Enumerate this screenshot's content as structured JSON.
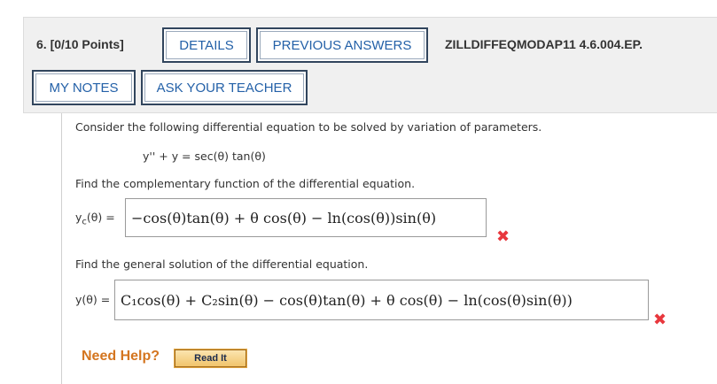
{
  "header": {
    "question_label": "6. [0/10 Points]",
    "details_label": "DETAILS",
    "previous_answers_label": "PREVIOUS ANSWERS",
    "assignment_code": "ZILLDIFFEQMODAP11 4.6.004.EP.",
    "my_notes_label": "MY NOTES",
    "ask_teacher_label": "ASK YOUR TEACHER"
  },
  "question": {
    "prompt": "Consider the following differential equation to be solved by variation of parameters.",
    "equation": "y'' + y = sec(θ) tan(θ)",
    "part1_prompt": "Find the complementary function of the differential equation.",
    "part1_label_var": "y",
    "part1_label_sub": "c",
    "part1_label_rest": "(θ) =",
    "part1_answer": "−cos(θ)tan(θ) + θ cos(θ) − ln(cos(θ))sin(θ)",
    "part2_prompt": "Find the general solution of the differential equation.",
    "part2_label": "y(θ) =",
    "part2_answer": "C₁cos(θ) + C₂sin(θ) − cos(θ)tan(θ) + θ cos(θ) − ln(cos(θ)sin(θ))"
  },
  "marks": {
    "incorrect": "✖"
  },
  "help": {
    "need_help": "Need Help?",
    "read_it": "Read It"
  },
  "colors": {
    "button_text": "#2461a8",
    "incorrect": "#e8373d",
    "help_text": "#d4751f"
  }
}
